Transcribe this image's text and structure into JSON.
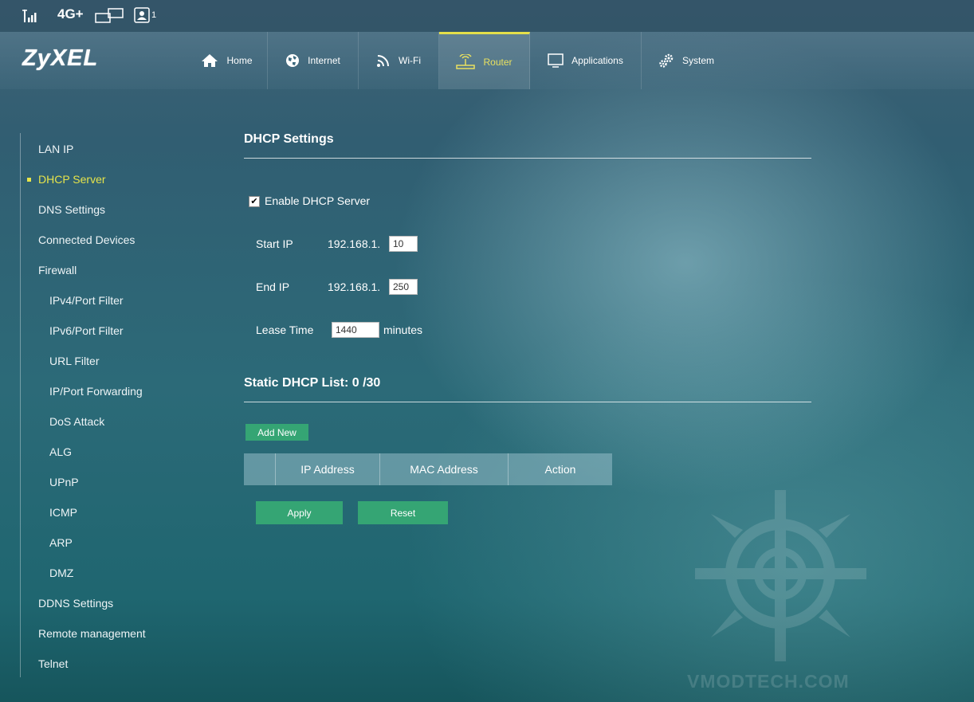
{
  "status_bar": {
    "network": "4G+",
    "connected_clients": "1",
    "icons": [
      "signal-icon",
      "network-type",
      "sms-icon",
      "user-icon"
    ]
  },
  "brand": {
    "logo": "ZyXEL"
  },
  "nav": {
    "active": "Router",
    "active_color": "#e8e060",
    "items": [
      {
        "label": "Home",
        "icon": "home-icon"
      },
      {
        "label": "Internet",
        "icon": "globe-icon"
      },
      {
        "label": "Wi-Fi",
        "icon": "wifi-icon"
      },
      {
        "label": "Router",
        "icon": "router-icon"
      },
      {
        "label": "Applications",
        "icon": "monitor-icon"
      },
      {
        "label": "System",
        "icon": "gear-icon"
      }
    ]
  },
  "sidebar": {
    "active": "DHCP Server",
    "items": [
      {
        "label": "LAN IP"
      },
      {
        "label": "DHCP Server"
      },
      {
        "label": "DNS Settings"
      },
      {
        "label": "Connected Devices"
      },
      {
        "label": "Firewall"
      },
      {
        "label": "IPv4/Port Filter"
      },
      {
        "label": "IPv6/Port Filter"
      },
      {
        "label": "URL Filter"
      },
      {
        "label": "IP/Port Forwarding"
      },
      {
        "label": "DoS Attack"
      },
      {
        "label": "ALG"
      },
      {
        "label": "UPnP"
      },
      {
        "label": "ICMP"
      },
      {
        "label": "ARP"
      },
      {
        "label": "DMZ"
      },
      {
        "label": "DDNS Settings"
      },
      {
        "label": "Remote management"
      },
      {
        "label": "Telnet"
      }
    ]
  },
  "dhcp": {
    "title": "DHCP Settings",
    "enable_label": "Enable DHCP Server",
    "enabled": true,
    "start_ip_label": "Start IP",
    "start_prefix": "192.168.1.",
    "start_value": "10",
    "end_ip_label": "End IP",
    "end_prefix": "192.168.1.",
    "end_value": "250",
    "lease_label": "Lease Time",
    "lease_value": "1440",
    "lease_unit": "minutes"
  },
  "static_list": {
    "title": "Static DHCP List: 0 /30",
    "add_new": "Add New",
    "columns": [
      "",
      "IP Address",
      "MAC Address",
      "Action"
    ]
  },
  "actions": {
    "apply": "Apply",
    "reset": "Reset",
    "button_color": "#35a574"
  },
  "watermark": "VMODTECH.COM"
}
